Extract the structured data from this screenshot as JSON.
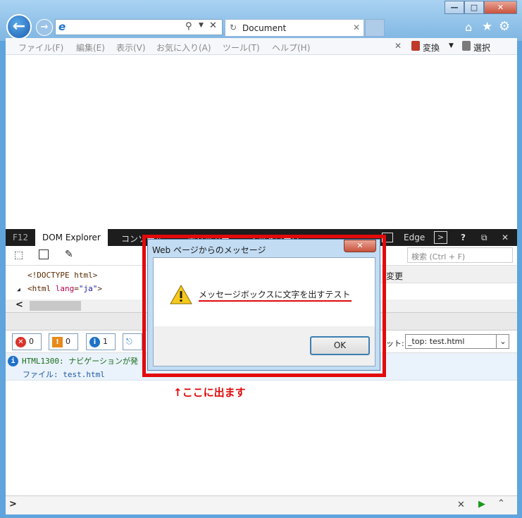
{
  "browser": {
    "tab_title": "Document",
    "menu": [
      "ファイル(F)",
      "編集(E)",
      "表示(V)",
      "お気に入り(A)",
      "ツール(T)",
      "ヘルプ(H)"
    ],
    "toolbar_right": {
      "convert": "変換",
      "select": "選択"
    },
    "caption_glyphs": {
      "minimize": "—",
      "maximize": "□",
      "close": "✕"
    }
  },
  "devtools": {
    "tabs": [
      "F12",
      "DOM Explorer",
      "コンソール",
      "デバッガー",
      "ネットワーク"
    ],
    "mode": "Edge",
    "search_placeholder": "検索 (Ctrl + F)",
    "dom_lines": {
      "doctype": "<!DOCTYPE html>",
      "html_open": "<html",
      "attr_name": "lang",
      "attr_value": "\"ja\"",
      "close": ">"
    },
    "side_label": "変更",
    "counts": {
      "errors": "0",
      "warnings": "0",
      "info": "1"
    },
    "target_label": "ット:",
    "target_value": "_top: test.html",
    "message": {
      "code": "HTML1300:",
      "text": "ナビゲーションが発",
      "file": "ファイル: test.html"
    },
    "input_prompt": ">"
  },
  "dialog": {
    "title": "Web ページからのメッセージ",
    "message": "メッセージボックスに文字を出すテスト",
    "ok_label": "OK"
  },
  "annotation": "↑ここに出ます",
  "colors": {
    "highlight_box": "#e20a0a",
    "annotation": "#e20a0a",
    "accent": "#1e72c8"
  }
}
